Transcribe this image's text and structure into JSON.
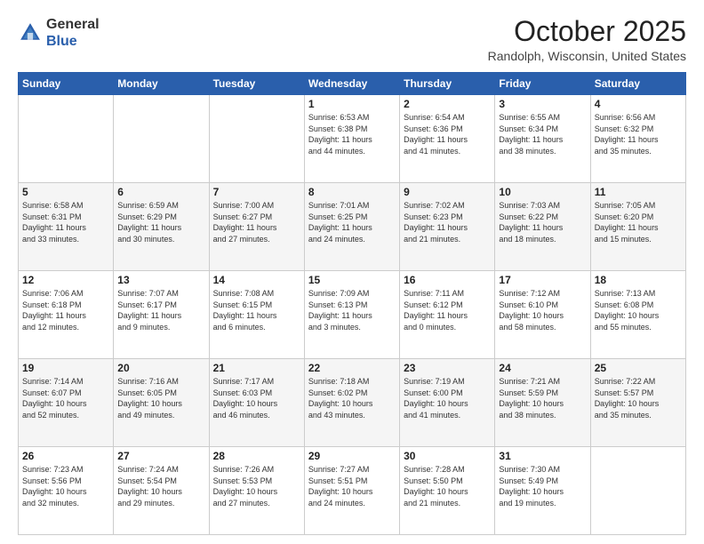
{
  "header": {
    "logo_general": "General",
    "logo_blue": "Blue",
    "month": "October 2025",
    "location": "Randolph, Wisconsin, United States"
  },
  "days_of_week": [
    "Sunday",
    "Monday",
    "Tuesday",
    "Wednesday",
    "Thursday",
    "Friday",
    "Saturday"
  ],
  "weeks": [
    [
      {
        "day": "",
        "info": ""
      },
      {
        "day": "",
        "info": ""
      },
      {
        "day": "",
        "info": ""
      },
      {
        "day": "1",
        "info": "Sunrise: 6:53 AM\nSunset: 6:38 PM\nDaylight: 11 hours\nand 44 minutes."
      },
      {
        "day": "2",
        "info": "Sunrise: 6:54 AM\nSunset: 6:36 PM\nDaylight: 11 hours\nand 41 minutes."
      },
      {
        "day": "3",
        "info": "Sunrise: 6:55 AM\nSunset: 6:34 PM\nDaylight: 11 hours\nand 38 minutes."
      },
      {
        "day": "4",
        "info": "Sunrise: 6:56 AM\nSunset: 6:32 PM\nDaylight: 11 hours\nand 35 minutes."
      }
    ],
    [
      {
        "day": "5",
        "info": "Sunrise: 6:58 AM\nSunset: 6:31 PM\nDaylight: 11 hours\nand 33 minutes."
      },
      {
        "day": "6",
        "info": "Sunrise: 6:59 AM\nSunset: 6:29 PM\nDaylight: 11 hours\nand 30 minutes."
      },
      {
        "day": "7",
        "info": "Sunrise: 7:00 AM\nSunset: 6:27 PM\nDaylight: 11 hours\nand 27 minutes."
      },
      {
        "day": "8",
        "info": "Sunrise: 7:01 AM\nSunset: 6:25 PM\nDaylight: 11 hours\nand 24 minutes."
      },
      {
        "day": "9",
        "info": "Sunrise: 7:02 AM\nSunset: 6:23 PM\nDaylight: 11 hours\nand 21 minutes."
      },
      {
        "day": "10",
        "info": "Sunrise: 7:03 AM\nSunset: 6:22 PM\nDaylight: 11 hours\nand 18 minutes."
      },
      {
        "day": "11",
        "info": "Sunrise: 7:05 AM\nSunset: 6:20 PM\nDaylight: 11 hours\nand 15 minutes."
      }
    ],
    [
      {
        "day": "12",
        "info": "Sunrise: 7:06 AM\nSunset: 6:18 PM\nDaylight: 11 hours\nand 12 minutes."
      },
      {
        "day": "13",
        "info": "Sunrise: 7:07 AM\nSunset: 6:17 PM\nDaylight: 11 hours\nand 9 minutes."
      },
      {
        "day": "14",
        "info": "Sunrise: 7:08 AM\nSunset: 6:15 PM\nDaylight: 11 hours\nand 6 minutes."
      },
      {
        "day": "15",
        "info": "Sunrise: 7:09 AM\nSunset: 6:13 PM\nDaylight: 11 hours\nand 3 minutes."
      },
      {
        "day": "16",
        "info": "Sunrise: 7:11 AM\nSunset: 6:12 PM\nDaylight: 11 hours\nand 0 minutes."
      },
      {
        "day": "17",
        "info": "Sunrise: 7:12 AM\nSunset: 6:10 PM\nDaylight: 10 hours\nand 58 minutes."
      },
      {
        "day": "18",
        "info": "Sunrise: 7:13 AM\nSunset: 6:08 PM\nDaylight: 10 hours\nand 55 minutes."
      }
    ],
    [
      {
        "day": "19",
        "info": "Sunrise: 7:14 AM\nSunset: 6:07 PM\nDaylight: 10 hours\nand 52 minutes."
      },
      {
        "day": "20",
        "info": "Sunrise: 7:16 AM\nSunset: 6:05 PM\nDaylight: 10 hours\nand 49 minutes."
      },
      {
        "day": "21",
        "info": "Sunrise: 7:17 AM\nSunset: 6:03 PM\nDaylight: 10 hours\nand 46 minutes."
      },
      {
        "day": "22",
        "info": "Sunrise: 7:18 AM\nSunset: 6:02 PM\nDaylight: 10 hours\nand 43 minutes."
      },
      {
        "day": "23",
        "info": "Sunrise: 7:19 AM\nSunset: 6:00 PM\nDaylight: 10 hours\nand 41 minutes."
      },
      {
        "day": "24",
        "info": "Sunrise: 7:21 AM\nSunset: 5:59 PM\nDaylight: 10 hours\nand 38 minutes."
      },
      {
        "day": "25",
        "info": "Sunrise: 7:22 AM\nSunset: 5:57 PM\nDaylight: 10 hours\nand 35 minutes."
      }
    ],
    [
      {
        "day": "26",
        "info": "Sunrise: 7:23 AM\nSunset: 5:56 PM\nDaylight: 10 hours\nand 32 minutes."
      },
      {
        "day": "27",
        "info": "Sunrise: 7:24 AM\nSunset: 5:54 PM\nDaylight: 10 hours\nand 29 minutes."
      },
      {
        "day": "28",
        "info": "Sunrise: 7:26 AM\nSunset: 5:53 PM\nDaylight: 10 hours\nand 27 minutes."
      },
      {
        "day": "29",
        "info": "Sunrise: 7:27 AM\nSunset: 5:51 PM\nDaylight: 10 hours\nand 24 minutes."
      },
      {
        "day": "30",
        "info": "Sunrise: 7:28 AM\nSunset: 5:50 PM\nDaylight: 10 hours\nand 21 minutes."
      },
      {
        "day": "31",
        "info": "Sunrise: 7:30 AM\nSunset: 5:49 PM\nDaylight: 10 hours\nand 19 minutes."
      },
      {
        "day": "",
        "info": ""
      }
    ]
  ]
}
